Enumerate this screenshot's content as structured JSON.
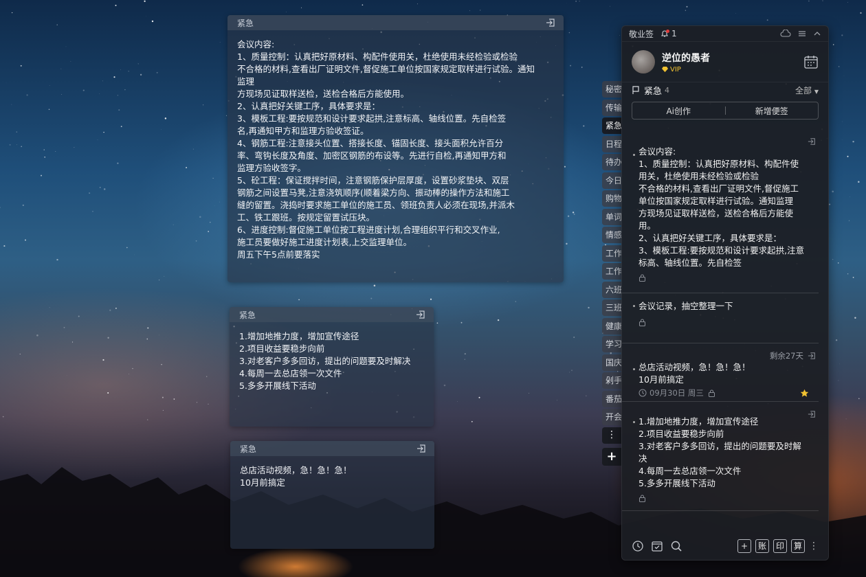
{
  "colors": {
    "accent_gold": "#f1c232",
    "panel_bg": "#1c1e24",
    "alert_red": "#e23b3b"
  },
  "desktop_notes": [
    {
      "tag": "紧急",
      "lines": [
        "会议内容:",
        "1、质量控制：认真把好原材料、构配件使用关，杜绝使用未经检验或检验",
        "不合格的材料,查看出厂证明文件,督促施工单位按国家规定取样进行试验。通知",
        "监理",
        "方现场见证取样送检，送检合格后方能使用。",
        "2、认真把好关键工序，具体要求是：",
        "3、模板工程:要按规范和设计要求起拱,注意标高、轴线位置。先自检签",
        "名,再通知甲方和监理方验收签证。",
        "4、钢筋工程:注意接头位置、搭接长度、锚固长度、接头面积允许百分",
        "率、弯钩长度及角度、加密区钢筋的布设等。先进行自检,再通知甲方和",
        "监理方验收签字。",
        "5、砼工程：保证搅拌时间，注意钢筋保护层厚度，设置砂浆垫块、双层",
        "钢筋之间设置马凳,注意浇筑顺序(顺着梁方向、振动棒的操作方法和施工",
        "缝的留置。浇捣时要求施工单位的施工员、领班负责人必须在现场,并派木",
        "工、铁工跟班。按规定留置试压块。",
        "6、进度控制:督促施工单位按工程进度计划,合理组织平行和交叉作业,",
        "施工员要做好施工进度计划表,上交监理单位。",
        "周五下午5点前要落实"
      ]
    },
    {
      "tag": "紧急",
      "lines": [
        "1.增加地推力度，增加宣传途径",
        "2.项目收益要稳步向前",
        "3.对老客户多多回访，提出的问题要及时解决",
        "4.每周一去总店领一次文件",
        "5.多多开展线下活动"
      ]
    },
    {
      "tag": "紧急",
      "lines": [
        "总店活动视频，急！急！急！",
        "10月前搞定"
      ]
    }
  ],
  "side_tabs": [
    "秘密",
    "传输",
    "紧急",
    "日程",
    "待办",
    "今日",
    "购物",
    "单词",
    "情感",
    "工作",
    "工作",
    "六班",
    "三班",
    "健康",
    "学习",
    "国庆",
    "剁手",
    "番茄",
    "开会"
  ],
  "side_tabs_active": 2,
  "side_more": "⋮",
  "side_add": "+",
  "panel": {
    "app_title": "敬业签",
    "notif_count": "1",
    "user_name": "逆位的愚者",
    "vip_label": "VIP",
    "category": "紧急",
    "category_count": "4",
    "filter": "全部",
    "btn_ai": "Ai创作",
    "btn_new": "新增便签",
    "items": [
      {
        "lines": [
          "会议内容:",
          "1、质量控制：认真把好原材料、构配件使",
          "用关，杜绝使用未经检验或检验",
          "不合格的材料,查看出厂证明文件,督促施工",
          "单位按国家规定取样进行试验。通知监理",
          "方现场见证取样送检，送检合格后方能使",
          "用。",
          "2、认真把好关键工序，具体要求是：",
          "3、模板工程:要按规范和设计要求起拱,注意",
          "标高、轴线位置。先自检签"
        ]
      },
      {
        "lines": [
          "会议记录，抽空整理一下"
        ]
      },
      {
        "remaining": "剩余27天",
        "lines": [
          "总店活动视频，急！急！急！",
          "10月前搞定"
        ],
        "date": "09月30日 周三"
      },
      {
        "lines": [
          "1.增加地推力度，增加宣传途径",
          "2.项目收益要稳步向前",
          "3.对老客户多多回访，提出的问题要及时解",
          "决",
          "4.每周一去总店领一次文件",
          "5.多多开展线下活动"
        ]
      }
    ],
    "toolbar_right": [
      "+",
      "账",
      "印",
      "算"
    ]
  }
}
